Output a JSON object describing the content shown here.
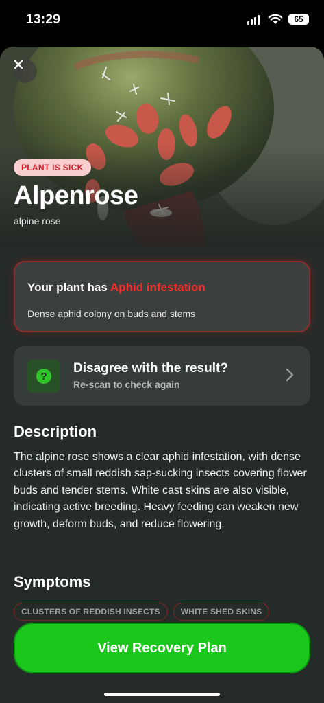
{
  "status_bar": {
    "time": "13:29",
    "battery": "65",
    "icons": [
      "cellular-signal-icon",
      "wifi-icon",
      "battery-icon"
    ]
  },
  "hero": {
    "image": "aphid-infested-flower-bud-photo",
    "close_icon": "close-icon",
    "badge": "PLANT IS SICK",
    "plant_name": "Alpenrose",
    "plant_common_name": "alpine rose"
  },
  "diagnosis": {
    "prefix": "Your plant has ",
    "disease": "Aphid infestation",
    "detail": "Dense aphid colony on buds and stems",
    "accent_color": "#ff2a2a"
  },
  "disagree": {
    "icon": "question-icon",
    "title": "Disagree with the result?",
    "subtitle": "Re-scan to check again",
    "chevron_icon": "chevron-right-icon"
  },
  "description": {
    "title": "Description",
    "text": "The alpine rose shows a clear aphid infestation, with dense clusters of small reddish sap-sucking insects covering flower buds and tender stems. White cast skins are also visible, indicating active breeding. Heavy feeding can weaken new growth, deform buds, and reduce flowering."
  },
  "symptoms": {
    "title": "Symptoms",
    "chips": [
      "CLUSTERS OF REDDISH INSECTS",
      "WHITE SHED SKINS"
    ]
  },
  "cta": {
    "label": "View Recovery Plan",
    "color": "#1ac71a"
  }
}
